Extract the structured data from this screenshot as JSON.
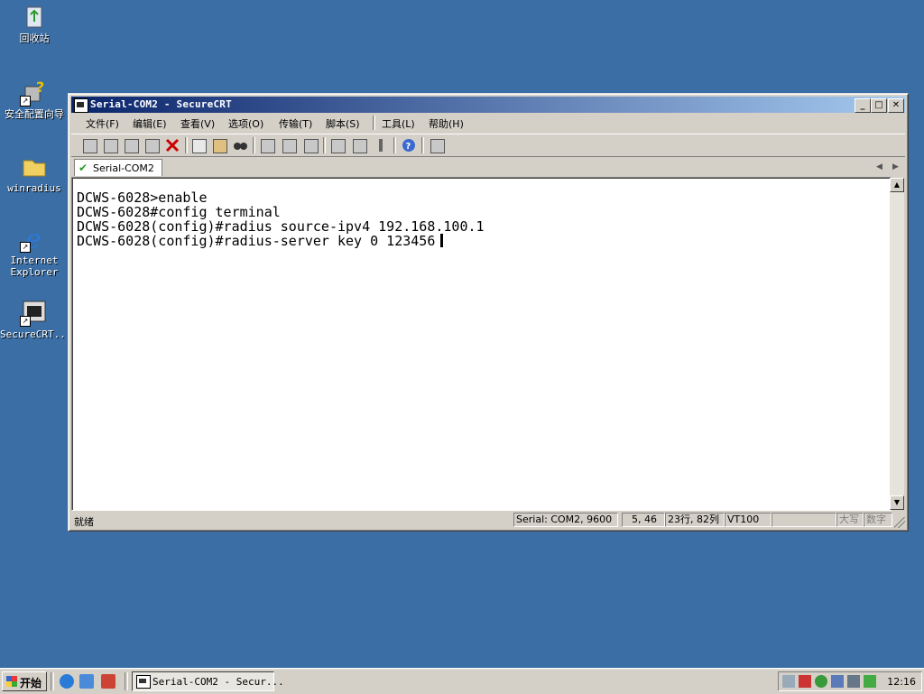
{
  "desktop": {
    "icons": [
      {
        "label": "回收站"
      },
      {
        "label": "安全配置向导"
      },
      {
        "label": "winradius"
      },
      {
        "label": "Internet\nExplorer"
      },
      {
        "label": "SecureCRT..."
      }
    ]
  },
  "window": {
    "title": "Serial-COM2 - SecureCRT",
    "controls": {
      "minimize": "_",
      "maximize": "□",
      "close": "✕"
    },
    "menu": [
      "文件(F)",
      "编辑(E)",
      "查看(V)",
      "选项(O)",
      "传输(T)",
      "脚本(S)",
      "工具(L)",
      "帮助(H)"
    ],
    "toolbar_icons": [
      "connect-icon",
      "quick-connect-icon",
      "connect-tab-icon",
      "reconnect-icon",
      "disconnect-icon",
      "copy-icon",
      "paste-icon",
      "find-icon",
      "print-icon",
      "print-selection-icon",
      "printer-setup-icon",
      "session-options-icon",
      "global-options-icon",
      "keymap-icon",
      "help-icon",
      "sftp-icon"
    ],
    "tab": {
      "label": "Serial-COM2"
    },
    "terminal_lines": [
      "DCWS-6028>enable",
      "DCWS-6028#config terminal",
      "DCWS-6028(config)#radius source-ipv4 192.168.100.1",
      "DCWS-6028(config)#radius-server key 0 123456"
    ],
    "status": {
      "ready": "就绪",
      "connection": "Serial: COM2, 9600",
      "cursor_pos": "5, 46",
      "size": "23行, 82列",
      "emulation": "VT100",
      "blank": "",
      "caps": "大写",
      "num": "数字"
    }
  },
  "taskbar": {
    "start_label": "开始",
    "quick_launch": [
      "ie-icon",
      "desktop-icon",
      "tool-icon"
    ],
    "task_label": "Serial-COM2 - Secur...",
    "tray_icons": [
      "tray-printer-icon",
      "tray-tool-icon",
      "tray-network-icon",
      "tray-computer-icon",
      "tray-monitor-icon",
      "tray-shield-icon"
    ],
    "clock": "12:16"
  },
  "colors": {
    "desktop": "#3a6ea5",
    "title_start": "#0a246a",
    "title_end": "#a6caf0",
    "chrome": "#d4d0c8"
  }
}
